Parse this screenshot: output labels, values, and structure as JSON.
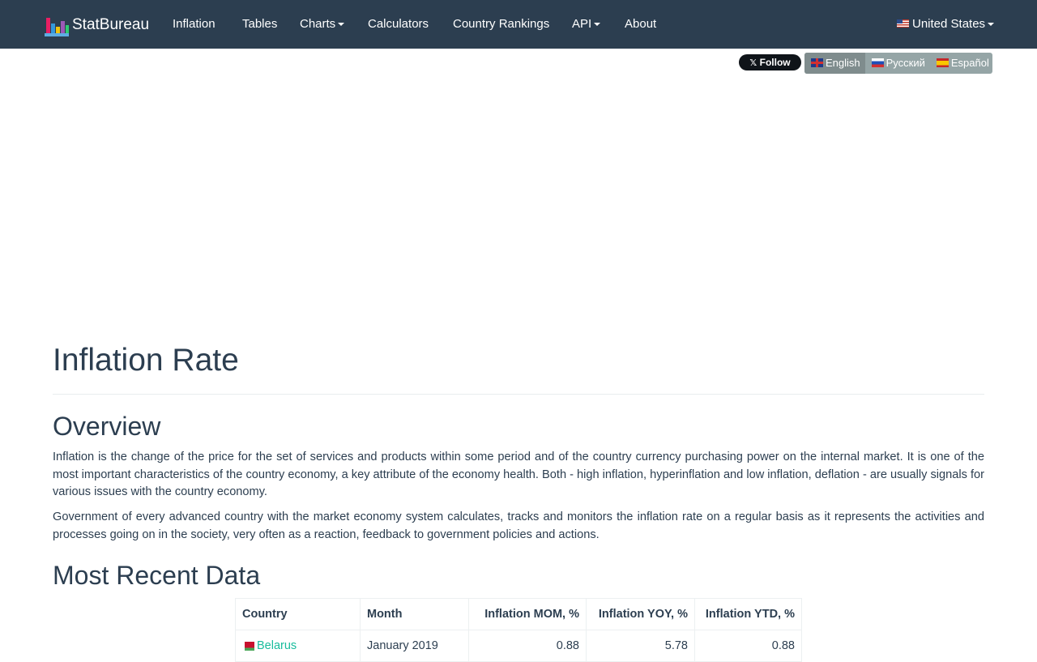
{
  "navbar": {
    "brand": "StatBureau",
    "items": [
      {
        "label": "Inflation",
        "dropdown": false
      },
      {
        "label": "Tables",
        "dropdown": false
      },
      {
        "label": "Charts",
        "dropdown": true
      },
      {
        "label": "Calculators",
        "dropdown": false
      },
      {
        "label": "Country Rankings",
        "dropdown": false
      },
      {
        "label": "API",
        "dropdown": true
      },
      {
        "label": "About",
        "dropdown": false
      }
    ],
    "country_selector": "United States",
    "background_color": "#2c3e50"
  },
  "social": {
    "follow_label": "Follow"
  },
  "languages": [
    {
      "label": "English",
      "active": true,
      "flag": "gb-flag-icon"
    },
    {
      "label": "Русский",
      "active": false,
      "flag": "ru-flag-icon"
    },
    {
      "label": "Español",
      "active": false,
      "flag": "es-flag-icon"
    }
  ],
  "main": {
    "title": "Inflation Rate",
    "overview_heading": "Overview",
    "overview_paragraphs": [
      "Inflation is the change of the price for the set of services and products within some period and of the country currency purchasing power on the internal market. It is one of the most important characteristics of the country economy, a key attribute of the economy health. Both - high inflation, hyperinflation and low inflation, deflation - are usually signals for various issues with the country economy.",
      "Government of every advanced country with the market economy system calculates, tracks and monitors the inflation rate on a regular basis as it represents the activities and processes going on in the society, very often as a reaction, feedback to government policies and actions."
    ],
    "recent_heading": "Most Recent Data",
    "table": {
      "headers": [
        "Country",
        "Month",
        "Inflation MOM, %",
        "Inflation YOY, %",
        "Inflation YTD, %"
      ],
      "rows": [
        {
          "country": "Belarus",
          "month": "January 2019",
          "mom": "0.88",
          "yoy": "5.78",
          "ytd": "0.88"
        }
      ]
    }
  },
  "colors": {
    "link": "#18bc9c",
    "text": "#2c3e50",
    "language_group": "#95a5a6"
  }
}
